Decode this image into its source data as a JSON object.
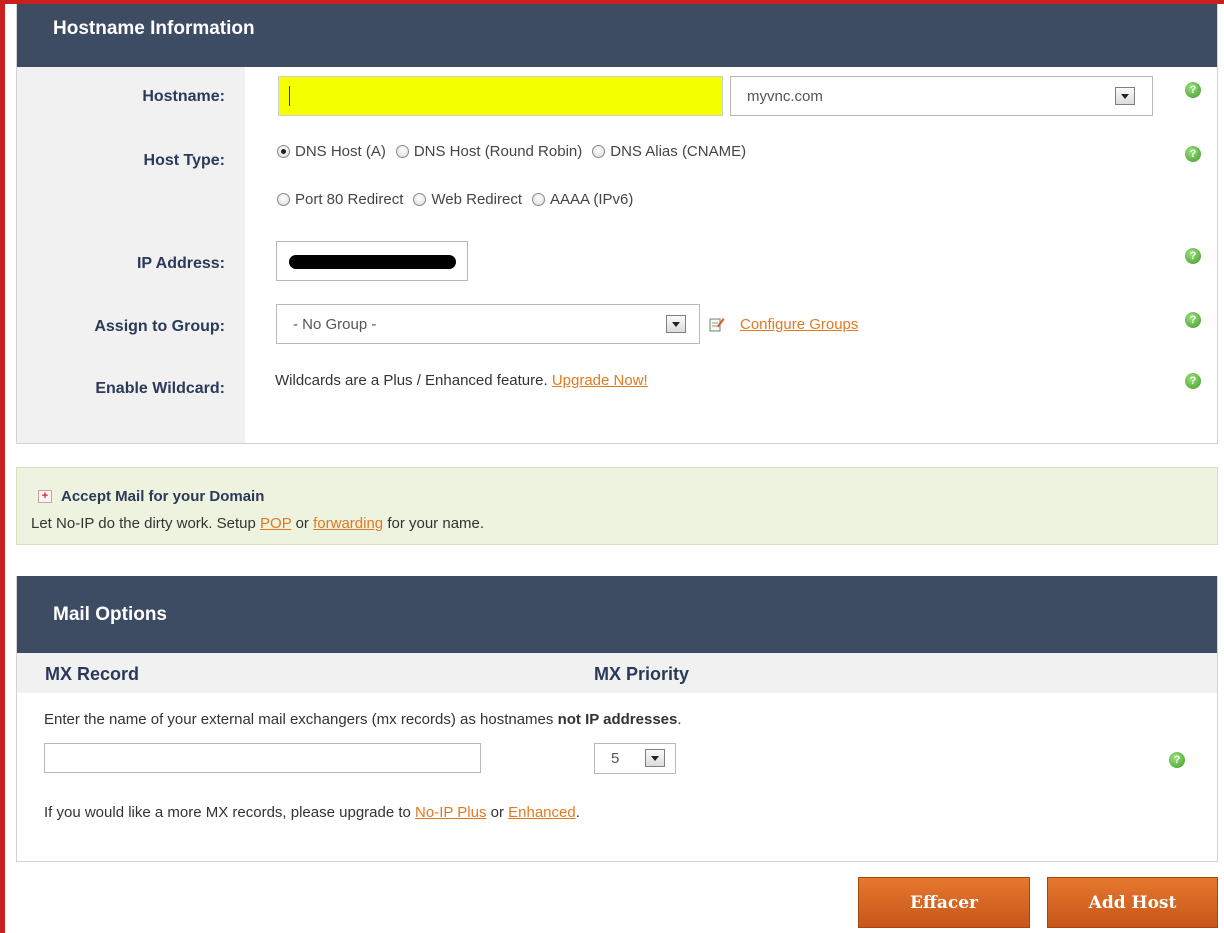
{
  "hostname_section": {
    "title": "Hostname Information",
    "hostname_label": "Hostname:",
    "hostname_value": "",
    "domain_selected": "myvnc.com",
    "host_type_label": "Host Type:",
    "host_types": [
      {
        "label": "DNS Host (A)",
        "checked": true
      },
      {
        "label": "DNS Host (Round Robin)",
        "checked": false
      },
      {
        "label": "DNS Alias (CNAME)",
        "checked": false
      },
      {
        "label": "Port 80 Redirect",
        "checked": false
      },
      {
        "label": "Web Redirect",
        "checked": false
      },
      {
        "label": "AAAA (IPv6)",
        "checked": false
      }
    ],
    "ip_label": "IP Address:",
    "group_label": "Assign to Group:",
    "group_selected": "- No Group -",
    "configure_groups_link": "Configure Groups",
    "wildcard_label": "Enable Wildcard:",
    "wildcard_text": "Wildcards are a Plus / Enhanced feature.",
    "upgrade_link": "Upgrade Now!",
    "help_glyph": "?"
  },
  "mail_promo": {
    "title": "Accept Mail for your Domain",
    "text_before": "Let No-IP do the dirty work. Setup",
    "pop_link": "POP",
    "text_or": "or",
    "forwarding_link": "forwarding",
    "text_after": "for your name.",
    "icon_glyph": "+"
  },
  "mail_section": {
    "title": "Mail Options",
    "mx_record_header": "MX Record",
    "mx_priority_header": "MX Priority",
    "instructions_prefix": "Enter the name of your external mail exchangers (mx records) as hostnames",
    "instructions_bold": "not IP addresses",
    "instructions_suffix": ".",
    "mx_record_value": "",
    "mx_priority_selected": "5",
    "upgrade_prefix": "If you would like a more MX records, please upgrade to",
    "noip_plus_link": "No-IP Plus",
    "upgrade_or": "or",
    "enhanced_link": "Enhanced",
    "upgrade_suffix": "."
  },
  "buttons": {
    "clear_label": "Effacer",
    "add_host_label": "Add Host"
  },
  "colors": {
    "header_bg": "#3e4c63",
    "label_color": "#2b3a58",
    "link_color": "#e07a22",
    "button_orange": "#d4621f",
    "promo_bg": "#eef3e0",
    "frame_red": "#c81f1f",
    "highlight_yellow": "#f4ff00"
  },
  "icons": [
    "help-icon",
    "dropdown-arrow-icon",
    "configure-groups-icon",
    "expand-plus-icon"
  ]
}
